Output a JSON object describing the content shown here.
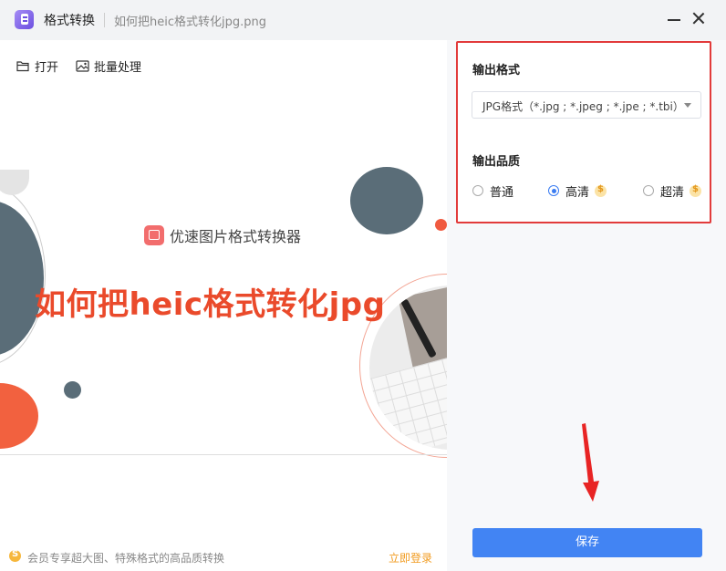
{
  "window": {
    "app_title": "格式转换",
    "file_name": "如何把heic格式转化jpg.png"
  },
  "toolbar": {
    "open_label": "打开",
    "batch_label": "批量处理"
  },
  "preview": {
    "brand_text": "优速图片格式转换器",
    "headline": "如何把heic格式转化jpg"
  },
  "footer": {
    "member_text": "会员专享超大图、特殊格式的高品质转换",
    "login_label": "立即登录"
  },
  "settings": {
    "format_label": "输出格式",
    "format_value": "JPG格式（*.jpg ; *.jpeg ; *.jpe ; *.tbi）",
    "quality_label": "输出品质",
    "quality_options": [
      {
        "label": "普通",
        "selected": false,
        "vip": false
      },
      {
        "label": "高清",
        "selected": true,
        "vip": true
      },
      {
        "label": "超清",
        "selected": false,
        "vip": true
      }
    ],
    "save_label": "保存"
  },
  "colors": {
    "accent": "#4284f3",
    "highlight_border": "#e23b3b",
    "headline": "#ea4a2b",
    "login_link": "#f19b1f"
  }
}
